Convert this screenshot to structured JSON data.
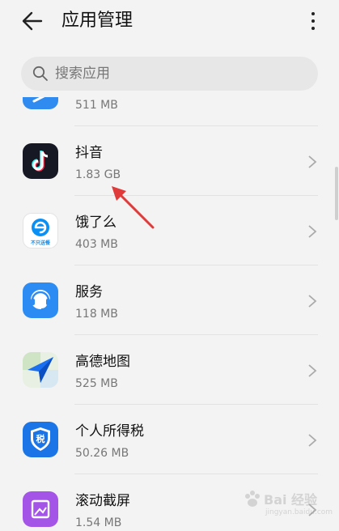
{
  "header": {
    "title": "应用管理",
    "back_icon": "arrow-left-icon",
    "more_icon": "more-vertical-icon"
  },
  "search": {
    "placeholder": "搜索应用",
    "value": "",
    "icon": "search-icon"
  },
  "apps": [
    {
      "name": "",
      "size": "511 MB",
      "icon": "partial-app-icon",
      "color": "#2f8bf0"
    },
    {
      "name": "抖音",
      "size": "1.83 GB",
      "icon": "douyin-icon",
      "color": "#161823"
    },
    {
      "name": "饿了么",
      "size": "403 MB",
      "icon": "eleme-icon",
      "color": "#0a8ff5",
      "icon_text": "不只送餐"
    },
    {
      "name": "服务",
      "size": "118 MB",
      "icon": "service-headset-icon",
      "color": "#2c8cf4"
    },
    {
      "name": "高德地图",
      "size": "525 MB",
      "icon": "amap-icon",
      "color": "#1a6ff0"
    },
    {
      "name": "个人所得税",
      "size": "50.26 MB",
      "icon": "tax-shield-icon",
      "color": "#1b75e6",
      "icon_text": "税"
    },
    {
      "name": "滚动截屏",
      "size": "1.54 MB",
      "icon": "scroll-screenshot-icon",
      "color": "#a455e8"
    }
  ],
  "annotation": {
    "icon": "red-arrow-icon",
    "color": "#e03a3a"
  },
  "watermark": {
    "text": "Bai 经验",
    "sub": "jingyan.baidu.com"
  }
}
